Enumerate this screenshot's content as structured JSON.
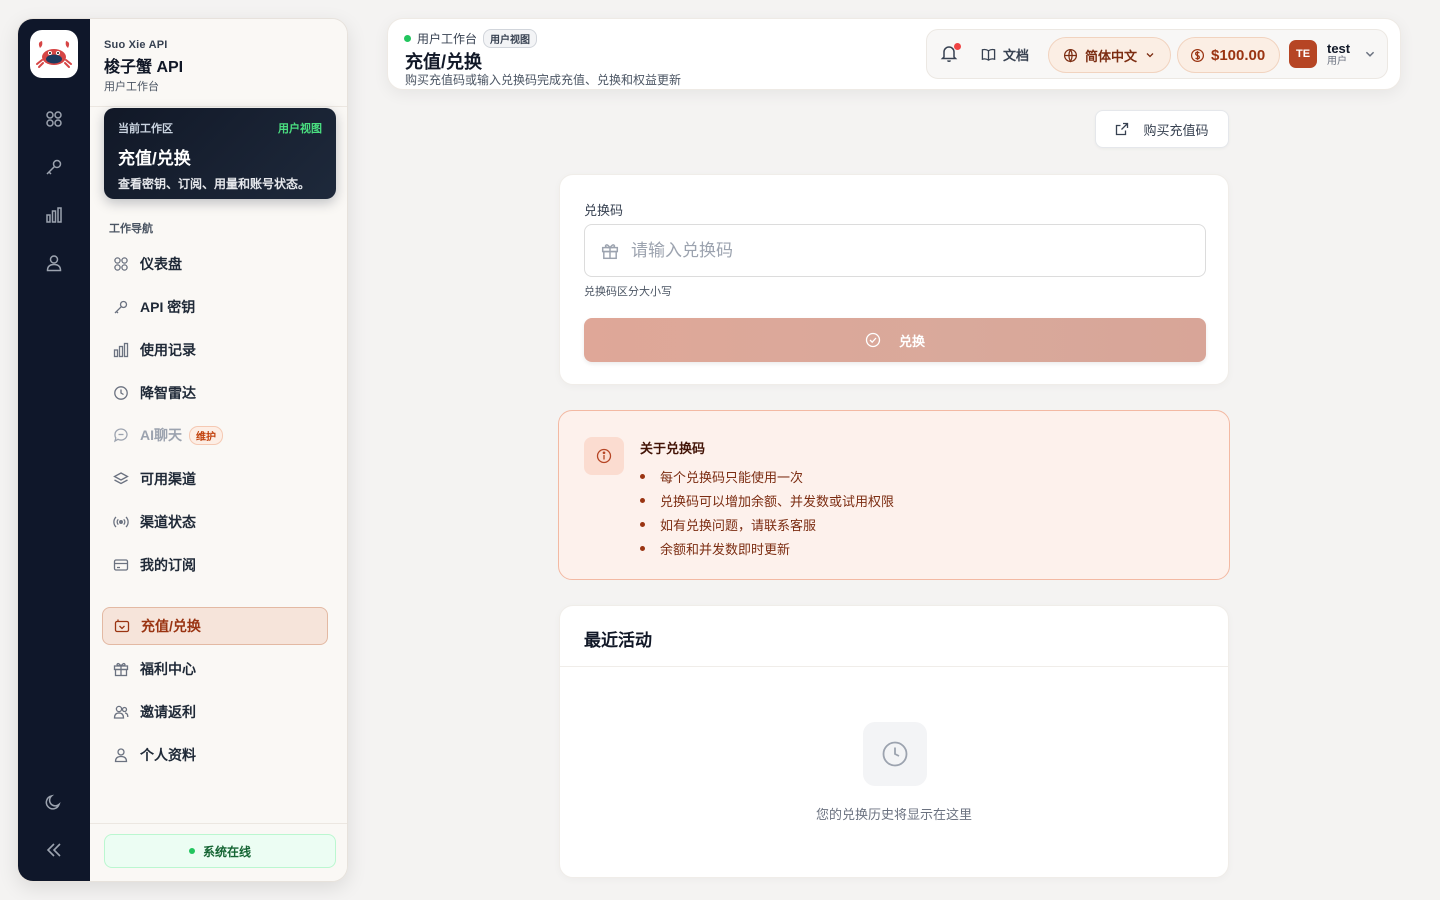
{
  "brand": {
    "en": "Suo Xie API",
    "name": "梭子蟹 API",
    "sub": "用户工作台"
  },
  "workspace": {
    "label": "当前工作区",
    "tag": "用户视图",
    "title": "充值/兑换",
    "desc": "查看密钥、订阅、用量和账号状态。"
  },
  "nav": {
    "heading": "工作导航",
    "items": [
      {
        "label": "仪表盘",
        "icon": "grid-icon"
      },
      {
        "label": "API 密钥",
        "icon": "key-icon"
      },
      {
        "label": "使用记录",
        "icon": "bar-chart-icon"
      },
      {
        "label": "降智雷达",
        "icon": "radar-icon"
      },
      {
        "label": "AI聊天",
        "icon": "chat-icon",
        "badge": "维护"
      },
      {
        "label": "可用渠道",
        "icon": "layers-icon"
      },
      {
        "label": "渠道状态",
        "icon": "signal-icon"
      },
      {
        "label": "我的订阅",
        "icon": "card-icon"
      },
      {
        "label": "充值/兑换",
        "icon": "wallet-icon"
      },
      {
        "label": "福利中心",
        "icon": "gift-icon"
      },
      {
        "label": "邀请返利",
        "icon": "users-icon"
      },
      {
        "label": "个人资料",
        "icon": "user-icon"
      }
    ]
  },
  "status": "系统在线",
  "header": {
    "crumb": "用户工作台",
    "crumb_chip": "用户视图",
    "title": "充值/兑换",
    "subtitle": "购买充值码或输入兑换码完成充值、兑换和权益更新",
    "docs": "文档",
    "language": "简体中文",
    "balance": "$100.00",
    "avatar": "TE",
    "username": "test",
    "role": "用户"
  },
  "buy_button": "购买充值码",
  "redeem": {
    "label": "兑换码",
    "placeholder": "请输入兑换码",
    "hint": "兑换码区分大小写",
    "button": "兑换"
  },
  "info": {
    "title": "关于兑换码",
    "items": [
      "每个兑换码只能使用一次",
      "兑换码可以增加余额、并发数或试用权限",
      "如有兑换问题，请联系客服",
      "余额和并发数即时更新"
    ]
  },
  "recent": {
    "title": "最近活动",
    "empty": "您的兑换历史将显示在这里"
  },
  "colors": {
    "accent": "#b64524",
    "sidebar_rail": "#0f172a",
    "online": "#22c55e"
  }
}
